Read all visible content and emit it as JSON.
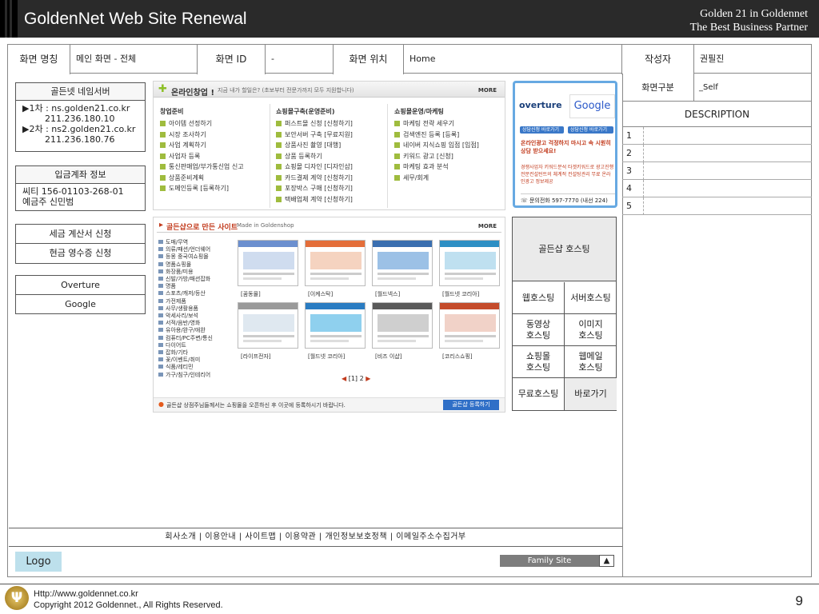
{
  "banner": {
    "title": "GoldenNet Web Site Renewal",
    "right_line1": "Golden 21 in Goldennet",
    "right_line2": "The Best Business Partner"
  },
  "info": {
    "screen_name_label": "화면 명칭",
    "screen_name_value": "메인 화면 - 전체",
    "screen_id_label": "화면 ID",
    "screen_id_value": "-",
    "screen_pos_label": "화면 위치",
    "screen_pos_value": "Home",
    "author_label": "작성자",
    "author_value": "권필진",
    "division_label": "화면구분",
    "division_value": "_Self",
    "description_label": "DESCRIPTION",
    "desc_rows": [
      "1",
      "2",
      "3",
      "4",
      "5"
    ]
  },
  "sidebar": {
    "nameserver_title": "골든넷 네임서버",
    "nameserver_text": "▶1차 : ns.golden21.co.kr\n        211.236.180.10\n▶2차 : ns2.golden21.co.kr\n        211.236.180.76",
    "account_title": "입금계좌 정보",
    "account_text": "씨티 156-01103-268-01\n예금주 신민범",
    "tax_invoice": "세금 계산서 신청",
    "cash_receipt": "현금 영수증 신청",
    "overture": "Overture",
    "google": "Google"
  },
  "startup": {
    "title": "온라인창업 !",
    "subtitle": "지금 내가 할일은? (초보부터 전문가까지 모두 지원합니다)",
    "more": "MORE",
    "col1_head": "창업준비",
    "col1": [
      "아이템 선정하기",
      "시장 조사하기",
      "사업 계획하기",
      "사업자 등록",
      "통신판매업/부가통신업 신고",
      "상품준비계획",
      "도메인등록 [등록하기]"
    ],
    "col2_head": "쇼핑몰구축(운영준비)",
    "col2": [
      "퍼스트몰 신청 [신청하기]",
      "보안서버 구축 [무료지원]",
      "상품사진 촬영 [대행]",
      "상품 등록하기",
      "쇼핑몰 디자인 [디자인샵]",
      "카드결제 계약 [신청하기]",
      "포장박스 구매 [신청하기]",
      "택배업체 계약 [신청하기]"
    ],
    "col3_head": "쇼핑몰운영/마케팅",
    "col3": [
      "마케팅 전략 세우기",
      "검색엔진 등록 [등록]",
      "네이버 지식쇼핑 입점 [입점]",
      "키워드 광고 [신청]",
      "마케팅 효과 분석",
      "세무/회계"
    ]
  },
  "ad": {
    "overture": "overture",
    "google": "Google",
    "btn1": "상담신청 바로가기",
    "btn2": "상담신청 바로가기",
    "text1": "온라인광고 걱정하지 마시고 속 시원히 상담 받으세요!",
    "text2": "경쟁사업자 키워드분석 타겟키워드로 광고진행 전문컨설턴트의 체계적 컨설팅관리 무료 온라인광고 정보제공",
    "phone": "문의전화 597-7770 (내선 224)"
  },
  "gallery": {
    "title": "골든샵으로 만든 사이트",
    "subtitle": "Made in Goldenshop",
    "more": "MORE",
    "categories": [
      "도매/무역",
      "의류/패션/언더웨어",
      "등몽 중국여쇼핑몰",
      "명품쇼핑몰",
      "화장품/미용",
      "신발/가방/패션잡화",
      "명품",
      "스포츠/캐저/등산",
      "가전제품",
      "사무/생활용품",
      "악세사리/보석",
      "서적/음반/영화",
      "유아용/완구/애완",
      "컴퓨터/PC주변/통신",
      "다이어트",
      "잡화/기타",
      "꽃/이벤트/취미",
      "식품/레티민",
      "가구/침구/인테리어"
    ],
    "sites_row1": [
      "[꿈동몰]",
      "[이케스탁]",
      "[월드넥스]",
      "[월드넷 코리아]"
    ],
    "sites_row2": [
      "[라이프전자]",
      "[월드넷 코리아]",
      "[비즈 이샵]",
      "[코리스쇼핑]"
    ],
    "pager": "[1] 2",
    "notice": "골든샵 상점주님들께서는 쇼핑몰을 오픈하신 후 이곳에 등록하시기 바랍니다.",
    "register_btn": "골든샵 등록하기"
  },
  "hosting": {
    "title": "골든샵 호스팅",
    "web": "웹호스팅",
    "server": "서버호스팅",
    "video": "동영상\n호스팅",
    "image": "이미지\n호스팅",
    "mall": "쇼핑몰\n호스팅",
    "webmail": "웹메일\n호스팅",
    "free": "무료호스팅",
    "shortcut": "바로가기"
  },
  "footer": {
    "links": "회사소개 | 이용안내 | 사이트맵 | 이용약관 | 개인정보보호정책 | 이메일주소수집거부",
    "logo": "Logo",
    "family_site": "Family Site",
    "family_arrow": "▲",
    "url": "Http://www.goldennet.co.kr",
    "copyright": "Copyright 2012 Goldennet., All Rights Reserved.",
    "page_number": "9"
  },
  "colors": {
    "accent_red": "#c23b1d",
    "accent_blue": "#123f9c",
    "ad_border": "#67a9e2",
    "logo_bg": "#bde0ec"
  }
}
